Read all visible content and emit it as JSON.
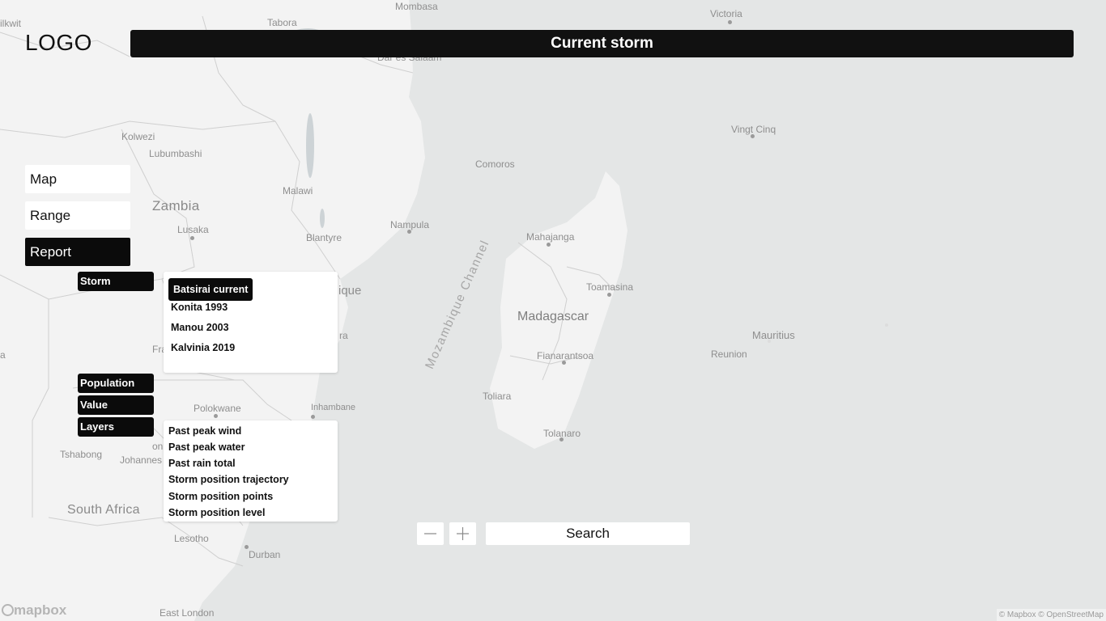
{
  "header": {
    "logo": "LOGO",
    "title": "Current storm"
  },
  "nav": {
    "map": "Map",
    "range": "Range",
    "report": "Report",
    "active": "Report"
  },
  "tags": {
    "storm": "Storm",
    "population": "Population",
    "value": "Value",
    "layers": "Layers"
  },
  "storms": {
    "selected": "Batsirai current",
    "items": [
      "Batsirai current",
      "Konita 1993",
      "Manou 2003",
      "Kalvinia 2019"
    ]
  },
  "layers": [
    "Past peak wind",
    "Past peak water",
    "Past rain total",
    "Storm position trajectory",
    "Storm position points",
    "Storm position level"
  ],
  "controls": {
    "zoom_out": "zoom-out-icon",
    "zoom_in": "zoom-in-icon",
    "search": "Search"
  },
  "map": {
    "labels": {
      "victoria": "Victoria",
      "tabora": "Tabora",
      "mombasa": "Mombasa",
      "dar": "Dar es Salaam",
      "kilwit": "ilkwit",
      "kolwezi": "Kolwezi",
      "lubumbashi": "Lubumbashi",
      "vingt": "Vingt Cinq",
      "comoros": "Comoros",
      "zambia": "Zambia",
      "malawi": "Malawi",
      "lusaka": "Lusaka",
      "nampula": "Nampula",
      "blantyre": "Blantyre",
      "channel": "Mozambique Channel",
      "mahajanga": "Mahajanga",
      "toamasina": "Toamasina",
      "madagascar": "Madagascar",
      "mauritius": "Mauritius",
      "reunion": "Reunion",
      "fianarantsoa": "Fianarantsoa",
      "toliara": "Toliara",
      "tolanaro": "Tolanaro",
      "polokwane": "Polokwane",
      "inhambane": "Inhambane",
      "tshabong": "Tshabong",
      "johannes": "Johannes",
      "southafrica": "South Africa",
      "lesotho": "Lesotho",
      "durban": "Durban",
      "eastlondon": "East London",
      "ique": "ique",
      "ra": "ra",
      "fra": "Fra",
      "on": "on",
      "ia": "a"
    },
    "mapbox_logo": "mapbox",
    "attribution": "© Mapbox © OpenStreetMap"
  }
}
